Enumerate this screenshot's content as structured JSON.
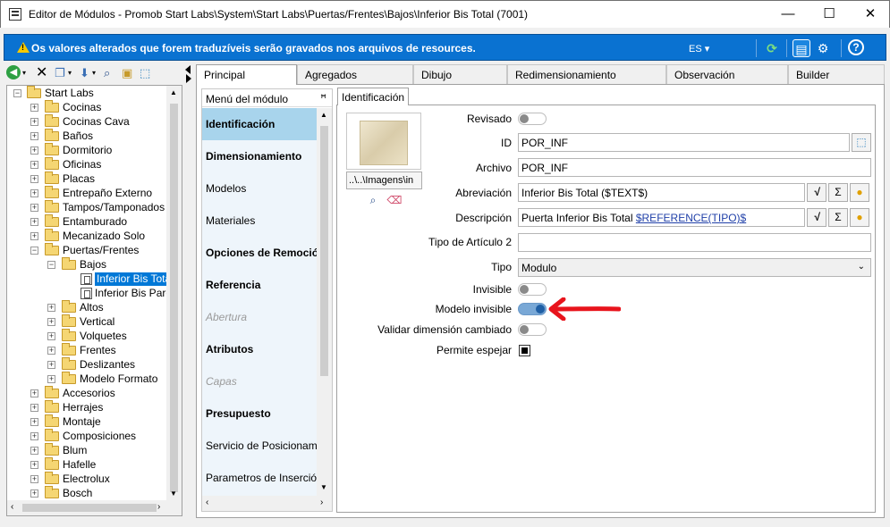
{
  "window": {
    "title": "Editor de Módulos - Promob Start Labs\\System\\Start Labs\\Puertas/Frentes\\Bajos\\Inferior Bis Total (7001)",
    "minimize": "—",
    "maximize": "☐",
    "close": "✕"
  },
  "infobar": {
    "message": "Os valores alterados que forem traduzíveis serão gravados nos arquivos de resources.",
    "language": "ES ▾",
    "accent": "#0a72d1"
  },
  "tree": {
    "root": "Start Labs",
    "items": [
      {
        "label": "Cocinas"
      },
      {
        "label": "Cocinas Cava"
      },
      {
        "label": "Baños"
      },
      {
        "label": "Dormitorio"
      },
      {
        "label": "Oficinas"
      },
      {
        "label": "Placas"
      },
      {
        "label": "Entrepaño Externo"
      },
      {
        "label": "Tampos/Tamponados"
      },
      {
        "label": "Entamburado"
      },
      {
        "label": "Mecanizado Solo"
      },
      {
        "label": "Puertas/Frentes"
      },
      {
        "label": "Bajos"
      },
      {
        "label": "Inferior Bis Total"
      },
      {
        "label": "Inferior Bis Parcial"
      },
      {
        "label": "Altos"
      },
      {
        "label": "Vertical"
      },
      {
        "label": "Volquetes"
      },
      {
        "label": "Frentes"
      },
      {
        "label": "Deslizantes"
      },
      {
        "label": "Modelo Formato"
      },
      {
        "label": "Accesorios"
      },
      {
        "label": "Herrajes"
      },
      {
        "label": "Montaje"
      },
      {
        "label": "Composiciones"
      },
      {
        "label": "Blum"
      },
      {
        "label": "Hafelle"
      },
      {
        "label": "Electrolux"
      },
      {
        "label": "Bosch"
      }
    ]
  },
  "tabs": [
    "Principal",
    "Agregados",
    "Dibujo",
    "Redimensionamiento",
    "Observación",
    "Builder"
  ],
  "menu": {
    "header": "Menú del módulo",
    "items": [
      "Identificación",
      "Dimensionamiento",
      "Modelos",
      "Materiales",
      "Opciones de Remoción",
      "Referencia",
      "Abertura",
      "Atributos",
      "Capas",
      "Presupuesto",
      "Servicio de Posicionamiento",
      "Parametros de Inserción"
    ]
  },
  "subtab": "Identificación",
  "preview": {
    "path": "..\\..\\Imagens\\in"
  },
  "form": {
    "revisado_label": "Revisado",
    "id_label": "ID",
    "id_value": "POR_INF",
    "archivo_label": "Archivo",
    "archivo_value": "POR_INF",
    "abreviacion_label": "Abreviación",
    "abreviacion_value": "Inferior Bis Total ($TEXT$)",
    "descripcion_label": "Descripción",
    "descripcion_prefix": "Puerta Inferior Bis Total ",
    "descripcion_ref": "$REFERENCE(TIPO)$",
    "tipo2_label": "Tipo de Artículo 2",
    "tipo2_value": "",
    "tipo_label": "Tipo",
    "tipo_value": "Modulo",
    "invisible_label": "Invisible",
    "modelo_invisible_label": "Modelo invisible",
    "validar_label": "Validar dimensión cambiado",
    "permite_label": "Permite espejar",
    "sigma": "Σ",
    "modelo_invisible_on": true,
    "arrow_color": "#e8141c"
  }
}
